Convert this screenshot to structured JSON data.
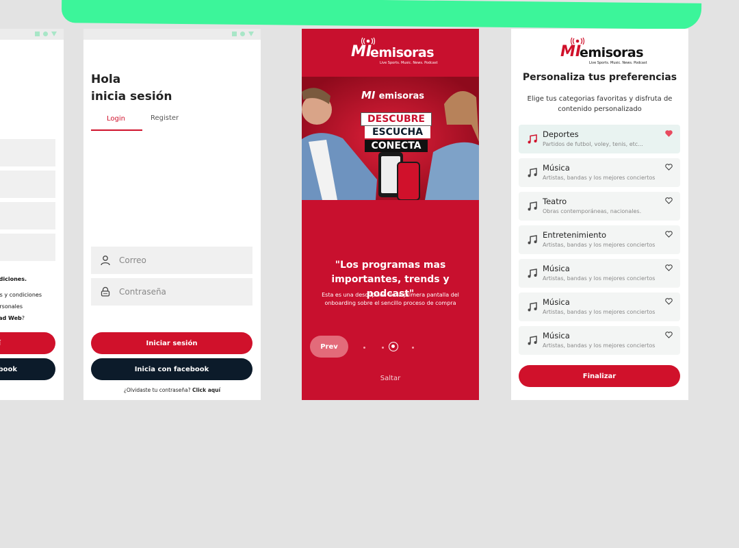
{
  "panel1": {
    "text1": "ndiciones.",
    "text2": "os y condiciones",
    "text3": "ersonales",
    "text4_bold": "dad Web",
    "text4_rest": "?",
    "button1": "í",
    "button2": "book"
  },
  "panel2": {
    "greeting": "Hola",
    "greeting2": "inicia sesión",
    "tab_login": "Login",
    "tab_register": "Register",
    "email_placeholder": "Correo",
    "password_placeholder": "Contraseña",
    "login_button": "Iniciar sesión",
    "facebook_button": "Inicia con facebook",
    "forgot_text": "¿Olvidaste tu contraseña?",
    "forgot_link": "Click aquí"
  },
  "panel3": {
    "logo_mi": "MI",
    "logo_text": "emisoras",
    "tagline": "Live Sports. Music. News. Podcast",
    "hero_line1": "DESCUBRE",
    "hero_line2": "ESCUCHA",
    "hero_line3": "CONECTA",
    "quote": "\"Los programas mas importantes, trends y podcast\"",
    "description": "Esta es una descripcion de la primera pantalla del onboarding sobre el sencillo proceso de compra",
    "prev_button": "Prev",
    "skip_link": "Saltar",
    "pagination_total": 4,
    "pagination_active": 2
  },
  "panel4": {
    "logo_mi": "MI",
    "logo_text": "emisoras",
    "tagline": "Live Sports. Music. News. Podcast",
    "title": "Personaliza tus preferencias",
    "subtitle": "Elige tus categorias favoritas y disfruta de contenido personalizado",
    "categories": [
      {
        "name": "Deportes",
        "desc": "Partidos de futbol, voley, tenis, etc...",
        "favorite": true
      },
      {
        "name": "Música",
        "desc": "Artistas, bandas y los mejores conciertos",
        "favorite": false
      },
      {
        "name": "Teatro",
        "desc": "Obras contemporáneas, nacionales.",
        "favorite": false
      },
      {
        "name": "Entretenimiento",
        "desc": "Artistas, bandas y los mejores conciertos",
        "favorite": false
      },
      {
        "name": "Música",
        "desc": "Artistas, bandas y los mejores conciertos",
        "favorite": false
      },
      {
        "name": "Música",
        "desc": "Artistas, bandas y los mejores conciertos",
        "favorite": false
      },
      {
        "name": "Música",
        "desc": "Artistas, bandas y los mejores conciertos",
        "favorite": false
      }
    ],
    "finish_button": "Finalizar"
  },
  "icons": {
    "status": [
      "square-icon",
      "circle-icon",
      "triangle-icon"
    ],
    "user": "user-icon",
    "lock": "lock-icon",
    "note": "music-note-icon",
    "heart": "heart-icon",
    "radio": "radio-signal-icon"
  },
  "colors": {
    "brand_red": "#d0112b",
    "dark_navy": "#0c1b2a",
    "highlight_green": "#3cf59a",
    "panel_red": "#c8102e"
  }
}
